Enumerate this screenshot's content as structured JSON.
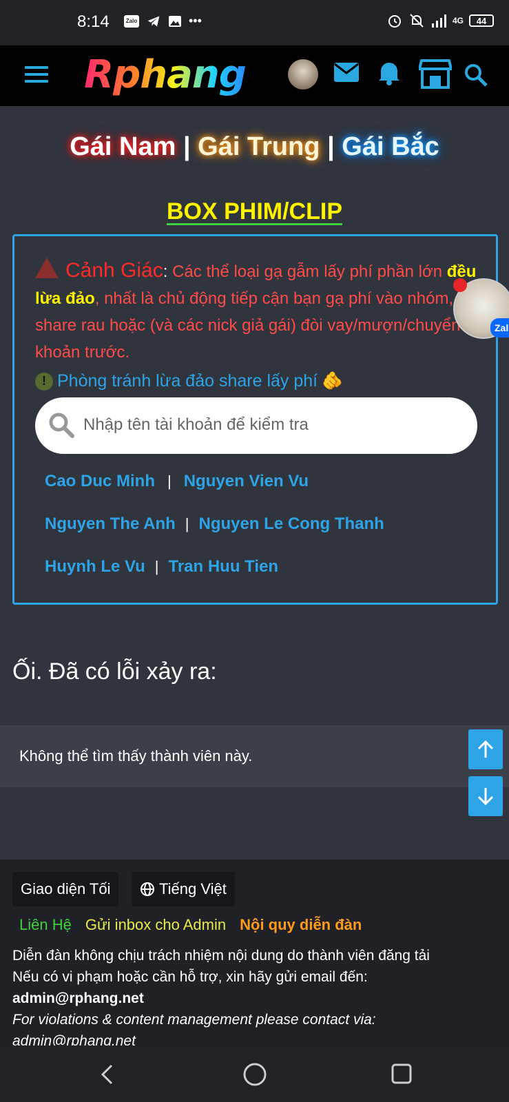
{
  "status_bar": {
    "time": "8:14",
    "zalo": "Zalo",
    "battery": "44",
    "more": "•••"
  },
  "header": {
    "logo": "Rphang"
  },
  "banner": {
    "gai_nam": "Gái Nam",
    "gai_trung": "Gái Trung",
    "gai_bac": "Gái Bắc",
    "separator": "|"
  },
  "box_title": "BOX PHIM/CLIP",
  "warning": {
    "head": "Cảnh Giác",
    "colon": ":",
    "text1": " Các thể loại gạ gẫm lấy phí phần lớn ",
    "highlight": "đều lừa đảo",
    "text2": ", nhất là chủ động tiếp cận bạn gạ phí vào nhóm, phí share rau hoặc (và các nick giả gái) đòi vay/mượn/chuyển khoản trước.",
    "info_link": "Phòng tránh lừa đảo share lấy phí",
    "info_emoji": "🫵"
  },
  "search": {
    "placeholder": "Nhập tên tài khoản để kiểm tra"
  },
  "names": [
    {
      "a": "Cao Duc Minh",
      "b": "Nguyen Vien Vu"
    },
    {
      "a": "Nguyen The Anh",
      "b": "Nguyen Le Cong Thanh"
    },
    {
      "a": "Huynh Le Vu",
      "b": "Tran Huu Tien"
    }
  ],
  "floating": {
    "zalo_label": "Zal"
  },
  "error": {
    "title": "Ối. Đã có lỗi xảy ra:",
    "message": "Không thể tìm thấy thành viên này."
  },
  "footer": {
    "theme_button": "Giao diện Tối",
    "language_button": "Tiếng Việt",
    "link_contact": "Liên Hệ",
    "link_inbox": "Gửi inbox cho Admin",
    "link_rules": "Nội quy diễn đàn",
    "line1": "Diễn đàn không chịu trách nhiệm nội dung do thành viên đăng tải",
    "line2": "Nếu có vi phạm hoặc cần hỗ trợ, xin hãy gửi email đến:",
    "email": "admin@rphang.net",
    "line3": "For violations & content management please contact via:",
    "email2": "admin@rphang.net"
  },
  "colors": {
    "accent": "#2ea4e6",
    "danger": "#ff4a4a",
    "highlight": "#fff200",
    "contact": "#3fd13f",
    "inbox": "#e8e84a",
    "rules": "#ff9a1a"
  }
}
